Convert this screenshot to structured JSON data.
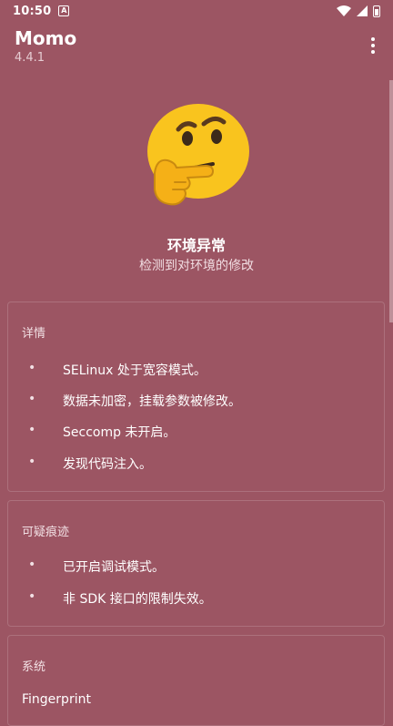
{
  "status_bar": {
    "time": "10:50",
    "notification_icon": "A"
  },
  "app": {
    "title": "Momo",
    "version": "4.4.1"
  },
  "result": {
    "emoji": "thinking-face",
    "title": "环境异常",
    "subtitle": "检测到对环境的修改"
  },
  "sections": {
    "details": {
      "title": "详情",
      "items": [
        "SELinux 处于宽容模式。",
        "数据未加密，挂载参数被修改。",
        "Seccomp 未开启。",
        "发现代码注入。"
      ]
    },
    "suspicious": {
      "title": "可疑痕迹",
      "items": [
        "已开启调试模式。",
        "非 SDK 接口的限制失效。"
      ]
    },
    "system": {
      "title": "系统",
      "first_label": "Fingerprint"
    }
  },
  "bullet_char": "•",
  "colors": {
    "background": "#9c5563",
    "emoji_yellow": "#f9c41e",
    "card_border": "rgba(255,255,255,0.16)"
  }
}
